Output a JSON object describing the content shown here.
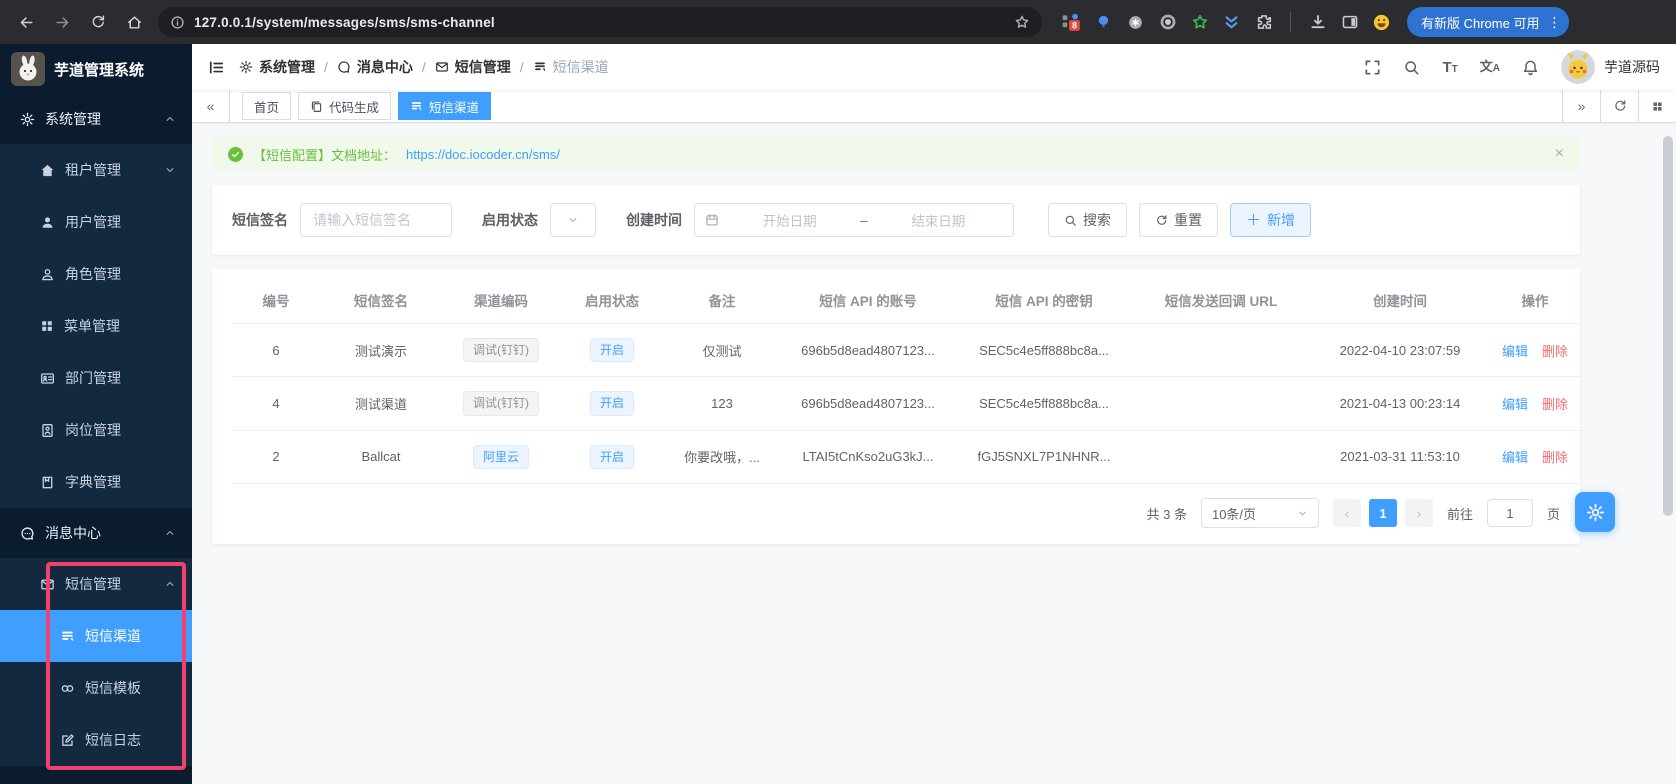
{
  "browser": {
    "url": "127.0.0.1/system/messages/sms/sms-channel",
    "update_button": "有新版 Chrome 可用",
    "extension_badge": "8"
  },
  "sidebar": {
    "title": "芋道管理系统",
    "menu": [
      {
        "label": "系统管理"
      },
      {
        "label": "租户管理"
      },
      {
        "label": "用户管理"
      },
      {
        "label": "角色管理"
      },
      {
        "label": "菜单管理"
      },
      {
        "label": "部门管理"
      },
      {
        "label": "岗位管理"
      },
      {
        "label": "字典管理"
      },
      {
        "label": "消息中心"
      },
      {
        "label": "短信管理"
      },
      {
        "label": "短信渠道"
      },
      {
        "label": "短信模板"
      },
      {
        "label": "短信日志"
      }
    ]
  },
  "breadcrumb": {
    "items": [
      {
        "label": "系统管理"
      },
      {
        "label": "消息中心"
      },
      {
        "label": "短信管理"
      },
      {
        "label": "短信渠道"
      }
    ]
  },
  "header": {
    "username": "芋道源码"
  },
  "tabs": {
    "items": [
      {
        "label": "首页"
      },
      {
        "label": "代码生成"
      },
      {
        "label": "短信渠道"
      }
    ]
  },
  "alert": {
    "text": "【短信配置】文档地址：",
    "link": "https://doc.iocoder.cn/sms/"
  },
  "filters": {
    "sign_label": "短信签名",
    "sign_placeholder": "请输入短信签名",
    "status_label": "启用状态",
    "date_label": "创建时间",
    "date_start": "开始日期",
    "date_separator": "–",
    "date_end": "结束日期",
    "search_button": "搜索",
    "reset_button": "重置",
    "add_button": "新增"
  },
  "table": {
    "columns": [
      "编号",
      "短信签名",
      "渠道编码",
      "启用状态",
      "备注",
      "短信 API 的账号",
      "短信 API 的密钥",
      "短信发送回调 URL",
      "创建时间",
      "操作"
    ],
    "rows": [
      {
        "id": "6",
        "sign": "测试演示",
        "code": "调试(钉钉)",
        "status": "开启",
        "remark": "仅测试",
        "account": "696b5d8ead4807123...",
        "secret": "SEC5c4e5ff888bc8a...",
        "callback": "",
        "created": "2022-04-10 23:07:59"
      },
      {
        "id": "4",
        "sign": "测试渠道",
        "code": "调试(钉钉)",
        "status": "开启",
        "remark": "123",
        "account": "696b5d8ead4807123...",
        "secret": "SEC5c4e5ff888bc8a...",
        "callback": "",
        "created": "2021-04-13 00:23:14"
      },
      {
        "id": "2",
        "sign": "Ballcat",
        "code": "阿里云",
        "status": "开启",
        "remark": "你要改哦，...",
        "account": "LTAI5tCnKso2uG3kJ...",
        "secret": "fGJ5SNXL7P1NHNR...",
        "callback": "",
        "created": "2021-03-31 11:53:10"
      }
    ],
    "edit_label": "编辑",
    "delete_label": "删除"
  },
  "pagination": {
    "total": "共 3 条",
    "page_size": "10条/页",
    "current_page": "1",
    "goto_label": "前往",
    "goto_value": "1",
    "unit_label": "页"
  },
  "colors": {
    "primary": "#409eff",
    "success": "#67c23a",
    "danger": "#f56c6c",
    "sidebar_bg": "#0b1c2f",
    "highlight_pink": "#f1416c"
  }
}
